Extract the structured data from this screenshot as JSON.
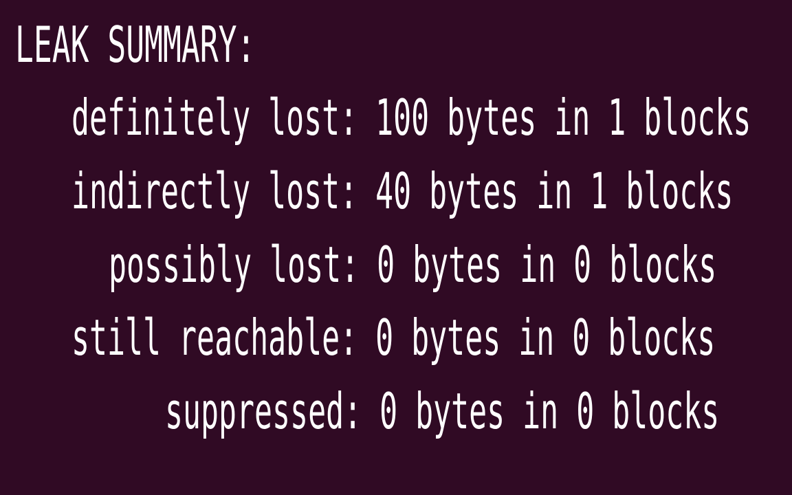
{
  "terminal": {
    "background_color": "#300a24",
    "text_color": "#ffffff",
    "lines": [
      "LEAK SUMMARY:",
      "definitely lost: 100 bytes in 1 blocks",
      "indirectly lost: 40 bytes in 1 blocks",
      "possibly lost: 0 bytes in 0 blocks",
      "still reachable: 0 bytes in 0 blocks",
      "suppressed: 0 bytes in 0 blocks"
    ]
  }
}
